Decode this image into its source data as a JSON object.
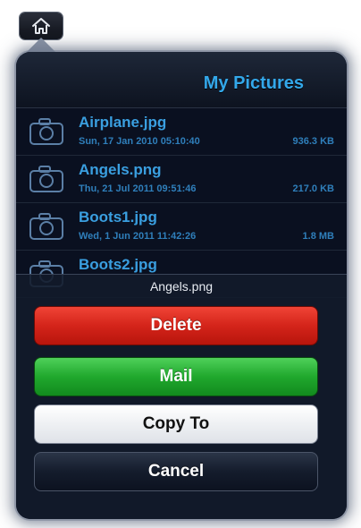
{
  "header": {
    "title": "My Pictures",
    "home_icon": "home-icon"
  },
  "files": [
    {
      "name": "Airplane.jpg",
      "date": "Sun, 17 Jan 2010 05:10:40",
      "size": "936.3 KB",
      "icon": "camera-icon"
    },
    {
      "name": "Angels.png",
      "date": "Thu, 21 Jul 2011 09:51:46",
      "size": "217.0 KB",
      "icon": "camera-icon"
    },
    {
      "name": "Boots1.jpg",
      "date": "Wed, 1 Jun 2011 11:42:26",
      "size": "1.8 MB",
      "icon": "camera-icon"
    },
    {
      "name": "Boots2.jpg",
      "date": "",
      "size": "",
      "icon": "camera-icon"
    }
  ],
  "action_sheet": {
    "title": "Angels.png",
    "delete_label": "Delete",
    "mail_label": "Mail",
    "copy_label": "Copy To",
    "cancel_label": "Cancel"
  },
  "colors": {
    "accent": "#33a8ea",
    "delete": "#d4241a",
    "mail": "#20a82d",
    "background": "#0a1020"
  }
}
